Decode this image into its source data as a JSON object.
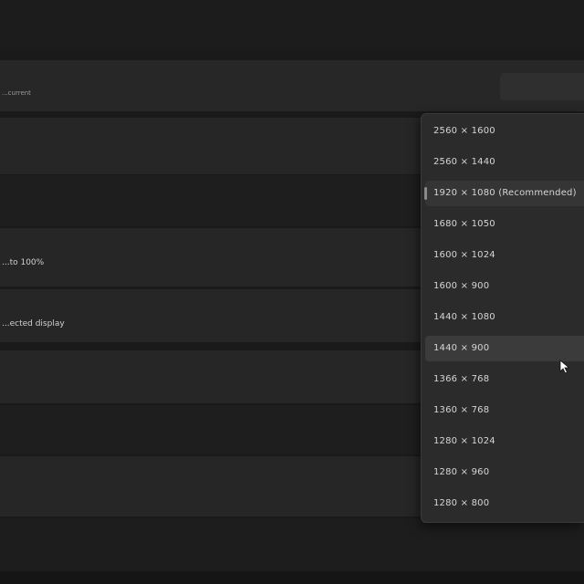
{
  "header": {
    "caption": "...current"
  },
  "rows": [
    {
      "label": ""
    },
    {
      "label": ""
    },
    {
      "label": "...to 100%"
    },
    {
      "label": "...ected display"
    },
    {
      "label": ""
    },
    {
      "label": ""
    },
    {
      "label": ""
    }
  ],
  "resolution_menu": {
    "items": [
      {
        "label": "2560 × 1600"
      },
      {
        "label": "2560 × 1440"
      },
      {
        "label": "1920 × 1080 (Recommended)",
        "selected": true
      },
      {
        "label": "1680 × 1050"
      },
      {
        "label": "1600 × 1024"
      },
      {
        "label": "1600 × 900"
      },
      {
        "label": "1440 × 1080"
      },
      {
        "label": "1440 × 900",
        "hovered": true
      },
      {
        "label": "1366 × 768"
      },
      {
        "label": "1360 × 768"
      },
      {
        "label": "1280 × 1024"
      },
      {
        "label": "1280 × 960"
      },
      {
        "label": "1280 × 800"
      }
    ]
  },
  "colors": {
    "background": "#1a1a1a",
    "panel": "#262626",
    "panel_dark": "#1e1e1e",
    "menu": "#2b2b2b",
    "hover": "#3b3b3b"
  },
  "icons": {
    "cursor": "mouse-pointer-icon"
  }
}
